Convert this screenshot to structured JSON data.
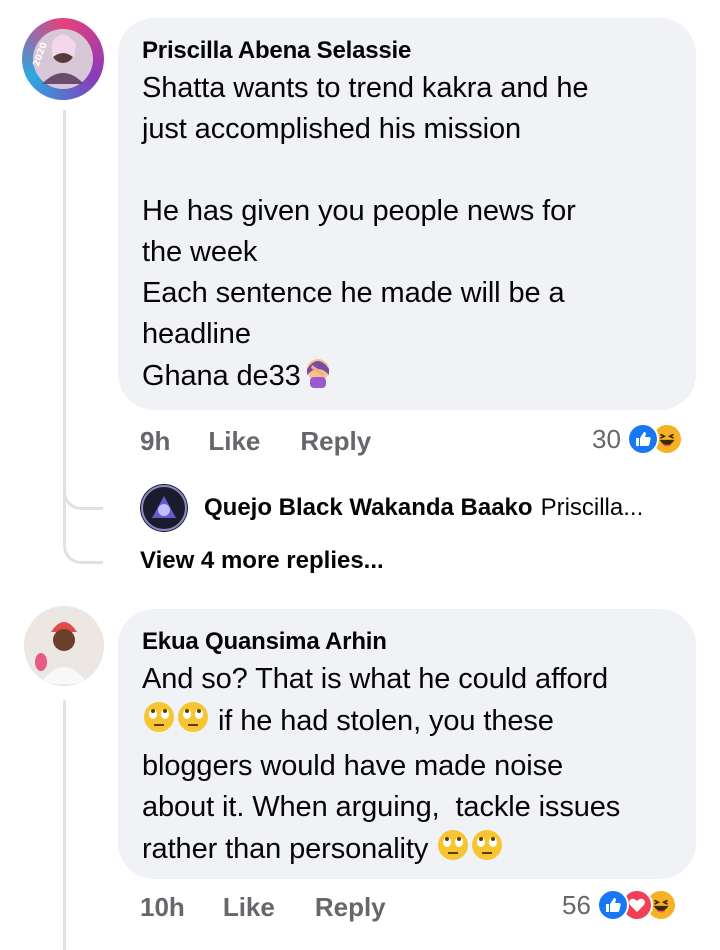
{
  "comments": [
    {
      "author": "Priscilla Abena Selassie",
      "lines": [
        "Shatta wants to trend kakra and he",
        "just accomplished his mission",
        "",
        "He has given you people news for",
        "the week",
        "Each sentence he made will be a",
        "headline",
        "Ghana de33"
      ],
      "time": "9h",
      "like_label": "Like",
      "reply_label": "Reply",
      "reaction_count": "30",
      "reactions": [
        "like-icon",
        "haha-icon"
      ],
      "avatar_text": "2020"
    },
    {
      "author": "Ekua Quansima Arhin",
      "lines": [
        "And so? That is what he could afford",
        "if he had stolen, you these",
        "bloggers would have made noise",
        "about it. When arguing,  tackle issues",
        "rather than personality"
      ],
      "time": "10h",
      "like_label": "Like",
      "reply_label": "Reply",
      "reaction_count": "56",
      "reactions": [
        "like-icon",
        "love-icon",
        "haha-icon"
      ]
    }
  ],
  "reply_preview": {
    "author": "Quejo Black Wakanda Baako",
    "snippet": "Priscilla..."
  },
  "view_more": "View 4 more replies...",
  "colors": {
    "bubble": "#f0f2f5",
    "meta": "#65676b",
    "like_blue": "#1877f2",
    "love_red": "#f33e58",
    "haha_yellow": "#f7b125"
  }
}
